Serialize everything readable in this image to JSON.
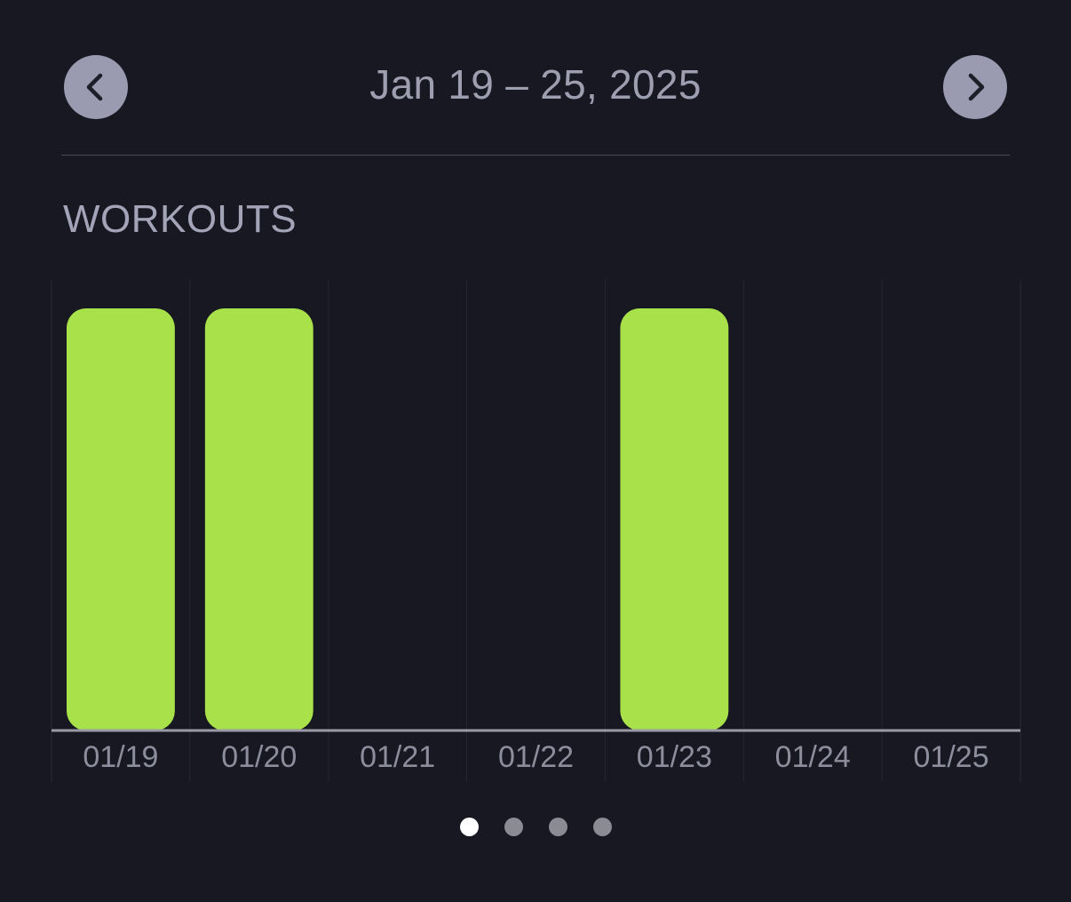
{
  "header": {
    "date_range": "Jan 19 – 25, 2025",
    "prev_icon": "chevron-left-icon",
    "next_icon": "chevron-right-icon"
  },
  "section": {
    "title": "WORKOUTS"
  },
  "colors": {
    "background": "#171821",
    "bar": "#a9e14a",
    "nav_button": "#9a9bb1",
    "text": "#9d9eb0"
  },
  "chart_data": {
    "type": "bar",
    "title": "WORKOUTS",
    "categories": [
      "01/19",
      "01/20",
      "01/21",
      "01/22",
      "01/23",
      "01/24",
      "01/25"
    ],
    "values": [
      1,
      1,
      0,
      0,
      1,
      0,
      0
    ],
    "ylim": [
      0,
      1
    ],
    "grid": true,
    "xlabel": "",
    "ylabel": ""
  },
  "pager": {
    "pages": 4,
    "active": 0
  }
}
